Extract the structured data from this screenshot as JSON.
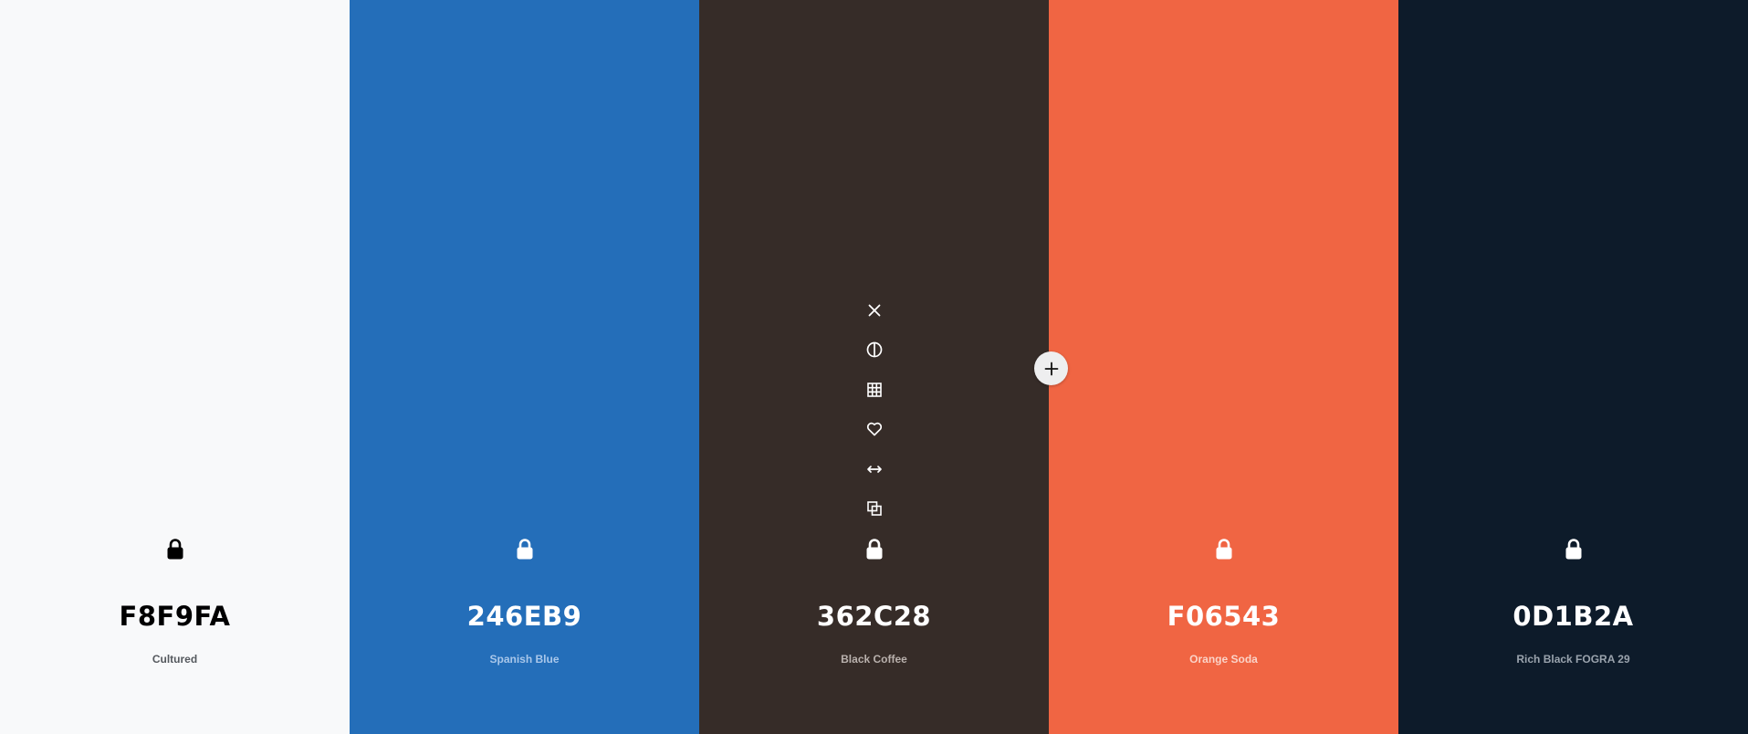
{
  "swatches": [
    {
      "hex": "F8F9FA",
      "name": "Cultured",
      "color": "#F8F9FA",
      "fg": "#000000",
      "name_color": "#55595e"
    },
    {
      "hex": "246EB9",
      "name": "Spanish Blue",
      "color": "#246EB9",
      "fg": "#ffffff",
      "name_color": "#a9c7ea"
    },
    {
      "hex": "362C28",
      "name": "Black Coffee",
      "color": "#362C28",
      "fg": "#ffffff",
      "name_color": "#b9b1ad"
    },
    {
      "hex": "F06543",
      "name": "Orange Soda",
      "color": "#F06543",
      "fg": "#ffffff",
      "name_color": "#fbd3c8"
    },
    {
      "hex": "0D1B2A",
      "name": "Rich Black FOGRA 29",
      "color": "#0D1B2A",
      "fg": "#ffffff",
      "name_color": "#9aa3ad"
    }
  ],
  "hover_tools": [
    "close-icon",
    "contrast-icon",
    "grid-icon",
    "heart-icon",
    "arrows-horizontal-icon",
    "copy-icon"
  ],
  "add_button": {
    "icon": "plus-icon"
  }
}
